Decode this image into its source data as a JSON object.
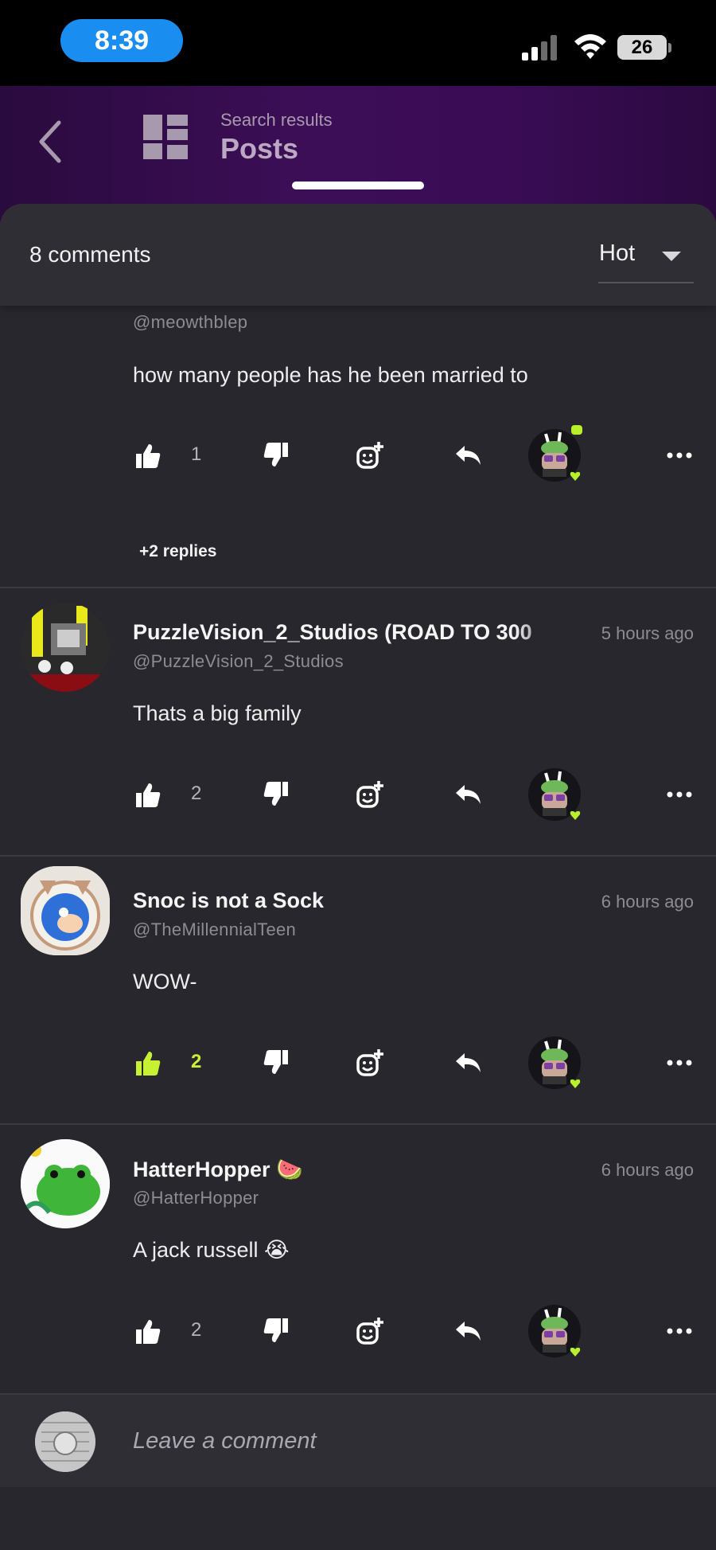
{
  "status_bar": {
    "time": "8:39",
    "battery": "26"
  },
  "header": {
    "subtitle": "Search results",
    "title": "Posts"
  },
  "sheet": {
    "comment_count": "8 comments",
    "sort_value": "Hot"
  },
  "comments": [
    {
      "handle": "@meowthblep",
      "body": "how many people has he been married to",
      "likes": "1",
      "liked": false,
      "replies": "+2 replies"
    },
    {
      "name": "PuzzleVision_2_Studios (ROAD TO 300",
      "handle": "@PuzzleVision_2_Studios",
      "time": "5 hours ago",
      "body": "Thats a big family",
      "likes": "2",
      "liked": false
    },
    {
      "name": "Snoc is not a Sock",
      "handle": "@TheMillennialTeen",
      "time": "6 hours ago",
      "body": "WOW-",
      "likes": "2",
      "liked": true
    },
    {
      "name": "HatterHopper 🍉",
      "handle": "@HatterHopper",
      "time": "6 hours ago",
      "body": "A jack russell 😭",
      "likes": "2",
      "liked": false
    }
  ],
  "composer": {
    "placeholder": "Leave a comment"
  },
  "colors": {
    "accent_like": "#c9f134",
    "header_purple": "#3d0e58",
    "time_pill": "#1a8ef0",
    "online": "#b8f02a"
  }
}
